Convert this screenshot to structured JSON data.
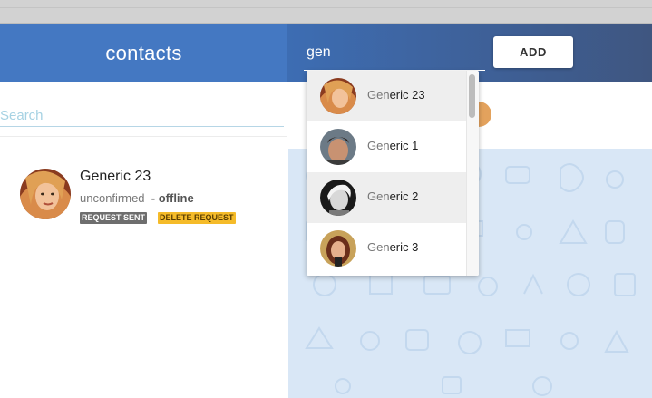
{
  "header": {
    "contacts_title": "contacts"
  },
  "search": {
    "value": "gen",
    "add_label": "ADD"
  },
  "left_panel": {
    "search_placeholder": "Search",
    "contact": {
      "name": "Generic 23",
      "status": "unconfirmed",
      "presence": "- offline",
      "badge_sent": "REQUEST SENT",
      "badge_delete": "DELETE REQUEST"
    }
  },
  "dropdown": {
    "items": [
      {
        "match": "Gen",
        "rest": "eric 23",
        "avatar_icon": "avatar-blonde-woman"
      },
      {
        "match": "Gen",
        "rest": "eric 1",
        "avatar_icon": "avatar-man-dark-hair"
      },
      {
        "match": "Gen",
        "rest": "eric 2",
        "avatar_icon": "avatar-woman-bw"
      },
      {
        "match": "Gen",
        "rest": "eric 3",
        "avatar_icon": "avatar-woman-brown-hair"
      }
    ],
    "highlighted": [
      0,
      2
    ]
  },
  "colors": {
    "header_blue": "#4478c2",
    "badge_sent": "#6e6e6e",
    "badge_delete": "#f5bb29",
    "pattern_bg": "#d9e7f6",
    "search_line": "#b6d6e6"
  }
}
